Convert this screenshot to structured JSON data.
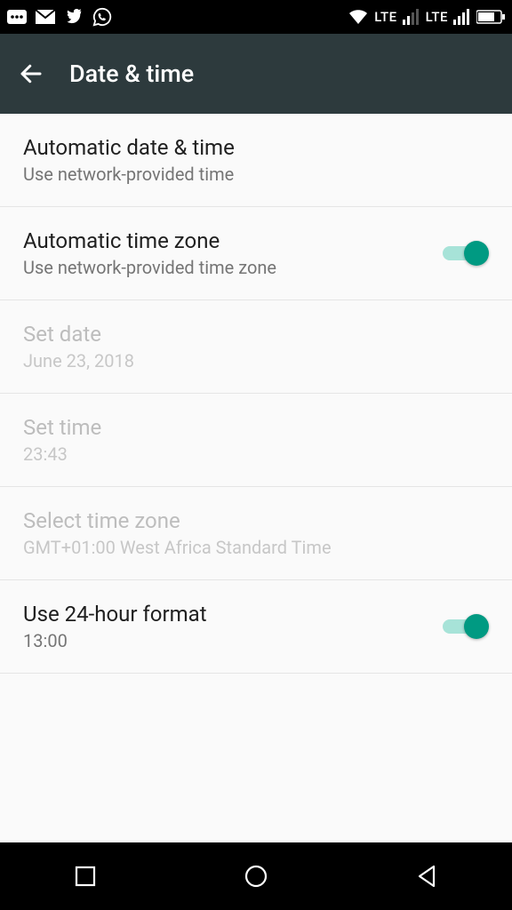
{
  "statusbar": {
    "lte1": "LTE",
    "lte2": "LTE"
  },
  "appbar": {
    "title": "Date & time"
  },
  "settings": {
    "auto_date": {
      "title": "Automatic date & time",
      "sub": "Use network-provided time"
    },
    "auto_tz": {
      "title": "Automatic time zone",
      "sub": "Use network-provided time zone"
    },
    "set_date": {
      "title": "Set date",
      "sub": "June 23, 2018"
    },
    "set_time": {
      "title": "Set time",
      "sub": "23:43"
    },
    "select_tz": {
      "title": "Select time zone",
      "sub": "GMT+01:00 West Africa Standard Time"
    },
    "use_24h": {
      "title": "Use 24-hour format",
      "sub": "13:00"
    }
  }
}
